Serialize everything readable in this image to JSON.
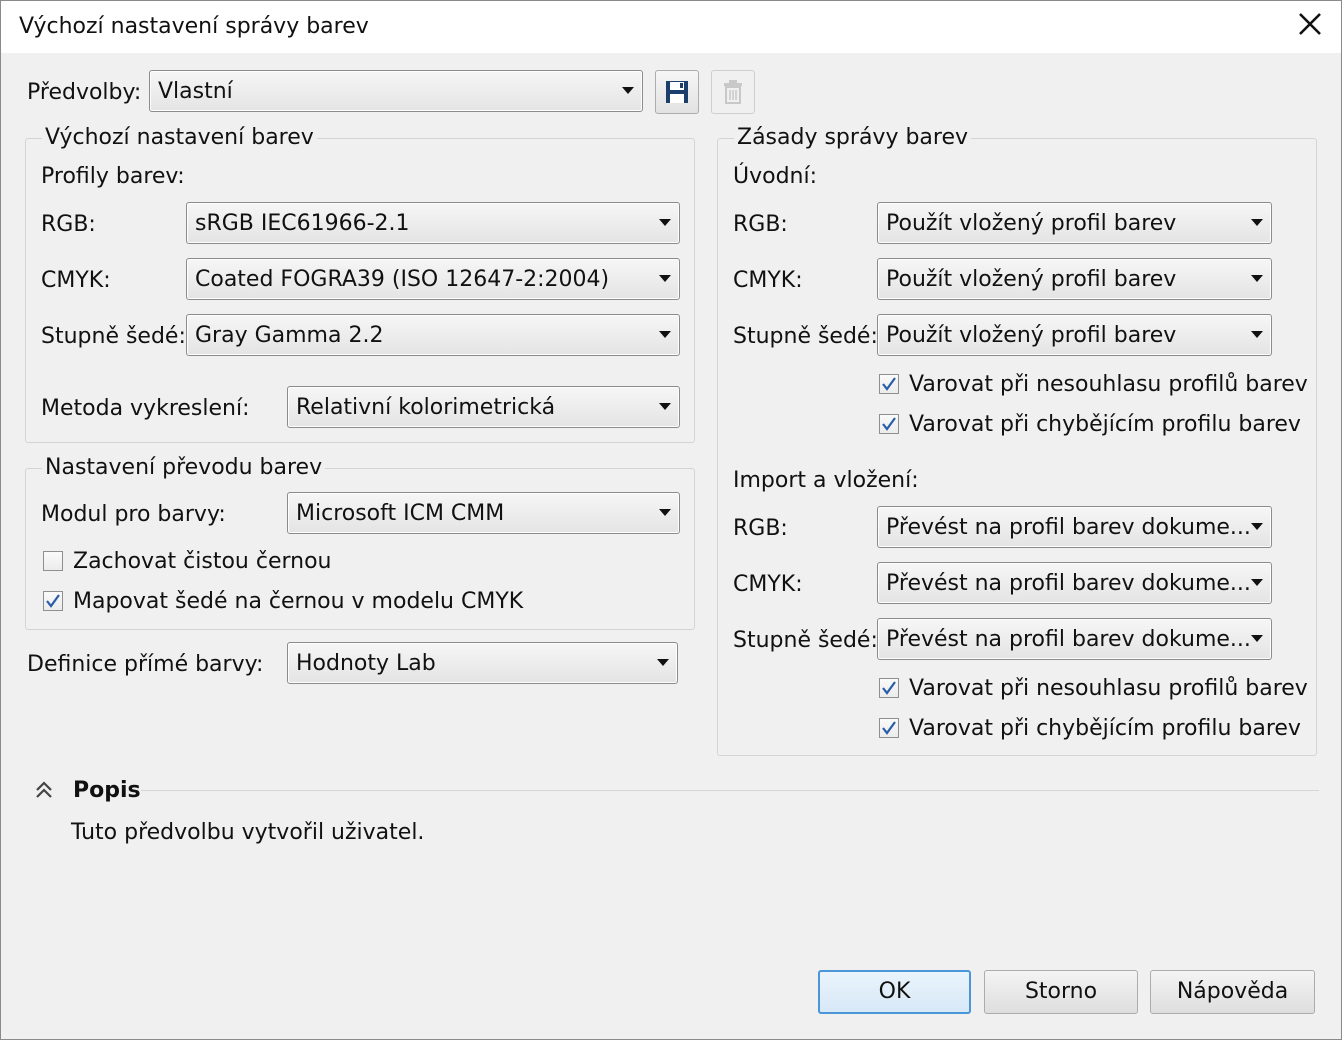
{
  "dialog": {
    "title": "Výchozí nastavení správy barev",
    "close_icon": "close-icon"
  },
  "presets": {
    "label": "Předvolby:",
    "value": "Vlastní",
    "save_icon": "save-icon",
    "delete_icon": "delete-icon"
  },
  "default_settings": {
    "legend": "Výchozí nastavení barev",
    "profiles_label": "Profily barev:",
    "rgb_label": "RGB:",
    "rgb_value": "sRGB IEC61966-2.1",
    "cmyk_label": "CMYK:",
    "cmyk_value": "Coated FOGRA39 (ISO 12647-2:2004)",
    "gray_label": "Stupně šedé:",
    "gray_value": "Gray Gamma 2.2",
    "render_label": "Metoda vykreslení:",
    "render_value": "Relativní kolorimetrická"
  },
  "conversion": {
    "legend": "Nastavení převodu barev",
    "module_label": "Modul pro barvy:",
    "module_value": "Microsoft ICM CMM",
    "keep_black_label": "Zachovat čistou černou",
    "keep_black_checked": false,
    "map_gray_label": "Mapovat šedé na černou v modelu CMYK",
    "map_gray_checked": true
  },
  "spot": {
    "label": "Definice přímé barvy:",
    "value": "Hodnoty Lab"
  },
  "policy": {
    "legend": "Zásady správy barev",
    "opening_label": "Úvodní:",
    "opening": {
      "rgb_label": "RGB:",
      "rgb_value": "Použít vložený profil barev",
      "cmyk_label": "CMYK:",
      "cmyk_value": "Použít vložený profil barev",
      "gray_label": "Stupně šedé:",
      "gray_value": "Použít vložený profil barev",
      "warn_mismatch_label": "Varovat při nesouhlasu profilů barev",
      "warn_mismatch_checked": true,
      "warn_missing_label": "Varovat při chybějícím profilu barev",
      "warn_missing_checked": true
    },
    "import_label": "Import a vložení:",
    "import": {
      "rgb_label": "RGB:",
      "rgb_value": "Převést na profil barev dokume...",
      "cmyk_label": "CMYK:",
      "cmyk_value": "Převést na profil barev dokume...",
      "gray_label": "Stupně šedé:",
      "gray_value": "Převést na profil barev dokume...",
      "warn_mismatch_label": "Varovat při nesouhlasu profilů barev",
      "warn_mismatch_checked": true,
      "warn_missing_label": "Varovat při chybějícím profilu barev",
      "warn_missing_checked": true
    }
  },
  "description": {
    "heading": "Popis",
    "collapse_icon": "double-chevron-up-icon",
    "text": "Tuto předvolbu vytvořil uživatel."
  },
  "buttons": {
    "ok": "OK",
    "cancel": "Storno",
    "help": "Nápověda"
  },
  "colors": {
    "focus_border": "#4b95d9",
    "window_bg": "#f0f0f0"
  }
}
